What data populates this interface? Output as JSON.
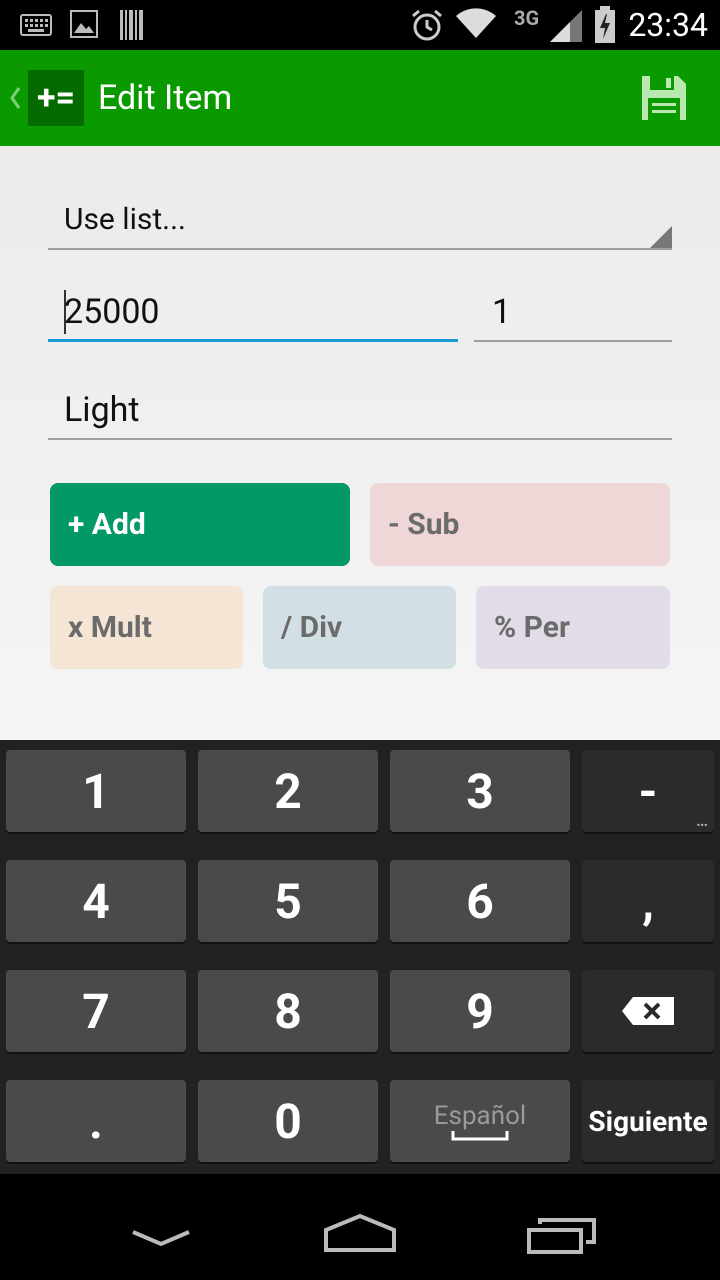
{
  "status_bar": {
    "time": "23:34",
    "network": "3G"
  },
  "app_bar": {
    "title": "Edit Item",
    "logo_text": "+="
  },
  "form": {
    "list_spinner": "Use list...",
    "amount": "25000",
    "quantity": "1",
    "name": "Light"
  },
  "operations": {
    "add": "+ Add",
    "sub": "- Sub",
    "mult": "x Mult",
    "div": "/ Div",
    "per": "% Per"
  },
  "keyboard": {
    "k1": "1",
    "k2": "2",
    "k3": "3",
    "minus": "-",
    "k4": "4",
    "k5": "5",
    "k6": "6",
    "comma": ",",
    "k7": "7",
    "k8": "8",
    "k9": "9",
    "dot": ".",
    "k0": "0",
    "language": "Español",
    "next": "Siguiente"
  },
  "colors": {
    "action_bar": "#0a9a00",
    "add_active": "#029967",
    "sub": "#efd6d7",
    "mult": "#f5e5d4",
    "div": "#d2e0e6",
    "per": "#e2dbe8",
    "focus_line": "#1a9bd3"
  }
}
